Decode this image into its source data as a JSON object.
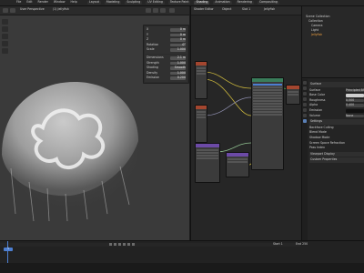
{
  "topbar": {
    "menu": [
      "File",
      "Edit",
      "Render",
      "Window",
      "Help"
    ],
    "workspaces": [
      "Layout",
      "Modeling",
      "Sculpting",
      "UV Editing",
      "Texture Paint",
      "Shading",
      "Animation",
      "Rendering",
      "Compositing"
    ]
  },
  "viewport": {
    "view_label": "User Perspective",
    "object_label": "(1) Jellyfish",
    "panel": {
      "rows": [
        {
          "label": "X",
          "value": "0 m"
        },
        {
          "label": "Y",
          "value": "0 m"
        },
        {
          "label": "Z",
          "value": "0 m"
        },
        {
          "label": "Rotation",
          "value": "0°"
        },
        {
          "label": "Scale",
          "value": "1.000"
        },
        {
          "label": "Dimensions",
          "value": "2.1 m"
        },
        {
          "label": "Strength",
          "value": "1.000"
        },
        {
          "label": "Shading",
          "value": "Smooth"
        },
        {
          "label": "Density",
          "value": "1.000"
        },
        {
          "label": "Emission",
          "value": "0.200"
        }
      ]
    }
  },
  "nodeeditor": {
    "title": "Shader Editor",
    "view_menu": "Object",
    "slot": "Slot 1",
    "material": "Jellyfish"
  },
  "outliner": {
    "title": "Scene Collection",
    "items": [
      "Collection",
      "Camera",
      "Light",
      "Jellyfish"
    ]
  },
  "properties": {
    "section1": "Surface",
    "rows": [
      {
        "k": "Surface",
        "v": "Principled BSDF"
      },
      {
        "k": "Base Color",
        "v": ""
      },
      {
        "k": "Roughness",
        "v": "0.500"
      },
      {
        "k": "Alpha",
        "v": "0.400"
      },
      {
        "k": "Emission",
        "v": ""
      },
      {
        "k": "Volume",
        "v": "None"
      }
    ],
    "settings": [
      "Settings",
      "Backface Culling",
      "Blend Mode",
      "Shadow Mode",
      "Screen Space Refraction",
      "Pass Index",
      "Viewport Display",
      "Custom Properties"
    ]
  },
  "timeline": {
    "frame": "1",
    "start": "Start 1",
    "end": "End 250"
  },
  "colors": {
    "accent": "#4d7fd1",
    "node_header_green": "#3a7d5a",
    "node_header_red": "#a3462f",
    "node_header_purple": "#6c4aa6",
    "node_header_gray": "#505050"
  }
}
